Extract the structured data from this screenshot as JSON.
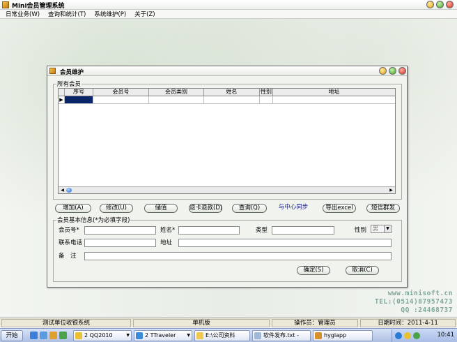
{
  "app": {
    "title": "Mini会员管理系统"
  },
  "menu": [
    {
      "label": "日常业务(W)"
    },
    {
      "label": "查询和统计(T)"
    },
    {
      "label": "系统维护(P)"
    },
    {
      "label": "关于(Z)"
    }
  ],
  "dialog": {
    "title": "会员维护",
    "members_group_label": "所有会员",
    "grid_columns": [
      "序号",
      "会员号",
      "会员类别",
      "姓名",
      "性别",
      "地址"
    ],
    "row_indicator": "▶",
    "info_group_label": "会员基本信息(*为必填字段)"
  },
  "buttons": {
    "add": "增加(A)",
    "edit": "修改(U)",
    "recharge": "储值",
    "refund": "退卡退款(D)",
    "query": "查询(Q)",
    "sync": "与中心同步",
    "export": "导出excel",
    "sms": "短信群发",
    "confirm": "确定(S)",
    "cancel": "取消(C)"
  },
  "form": {
    "member_no_label": "会员号*",
    "name_label": "姓名*",
    "type_label": "类型",
    "gender_label": "性别",
    "gender_value": "男",
    "phone_label": "联系电话",
    "address_label": "地址",
    "remark_label": "备　注",
    "member_no_value": "",
    "name_value": "",
    "type_value": "",
    "phone_value": "",
    "address_value": "",
    "remark_value": ""
  },
  "branding": {
    "site": "www.minisoft.cn",
    "tel": "TEL:(0514)87957473",
    "qq": "QQ :24468737"
  },
  "statusbar": {
    "unit": "测试单位收银系统",
    "edition": "单机版",
    "operator": "操作员：管理员",
    "date": "日期时间：2011-4-11"
  },
  "taskbar": {
    "start_label": "开始",
    "tasks": [
      {
        "label": "2 QQ2010"
      },
      {
        "label": "2 TTraveler"
      },
      {
        "label": "E:\\公司资料"
      },
      {
        "label": "软件发布.txt -"
      },
      {
        "label": "hyglapp"
      }
    ],
    "clock": "10:41"
  },
  "colors": {
    "dialog_bg": "#f1f3ee",
    "selected_cell": "#0a246a",
    "branding": "#7fa89a"
  }
}
